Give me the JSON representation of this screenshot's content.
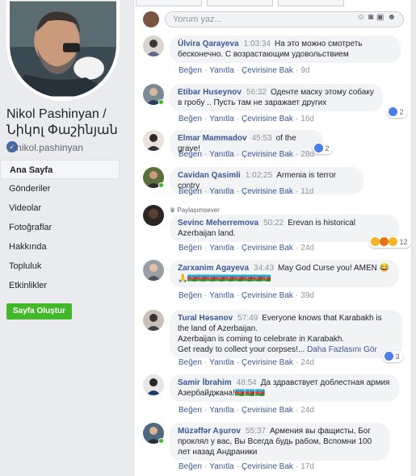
{
  "sidebar": {
    "page_name": "Nikol Pashinyan / Նիկոլ Փաշինյան",
    "verified_mark": "✓",
    "handle": "@nikol.pashinyan",
    "nav_items": [
      "Ana Sayfa",
      "Gönderiler",
      "Videolar",
      "Fotoğraflar",
      "Hakkında",
      "Topluluk",
      "Etkinlikler"
    ],
    "create_page_label": "Sayfa Oluştur"
  },
  "composer": {
    "placeholder": "Yorum yaz...",
    "icons": [
      "emoji-icon",
      "camera-icon",
      "gif-icon",
      "sticker-icon"
    ]
  },
  "labels": {
    "like": "Beğen",
    "reply": "Yanıtla",
    "translate": "Çevirisine Bak",
    "sep": "·",
    "sharer": "Paylaşımsever",
    "see_more": "Daha Fazlasını Gör"
  },
  "comments": [
    {
      "author": "Ülvira Qarayeva",
      "time": "1:03:34",
      "text": "На это можно смотреть бесконечно. С возрастающим удовольствием",
      "ago": "9d"
    },
    {
      "author": "Etibar Huseynov",
      "time": "56:32",
      "text": "Оденте маску этому собаку в гробу .. Пусть там не заражает других",
      "ago": "16d",
      "reactions": "2"
    },
    {
      "author": "Elmar Mammadov",
      "time": "45:53",
      "text": "of the grave!",
      "ago": "28d",
      "reactions": "2"
    },
    {
      "author": "Cavidan Qasimli",
      "time": "1:02:25",
      "text": "Armenia is terror contry",
      "ago": "11d"
    },
    {
      "author": "Sevinc Meherremova",
      "time": "50:22",
      "text": "Erevan is historical Azerbaijan land.",
      "ago": "24d",
      "reactions": "12"
    },
    {
      "author": "Zarxanim Agayeva",
      "time": "34:43",
      "text": "May God Curse you! AMEN 😂",
      "text2": "🙏🇦🇿🇦🇿🇦🇿🇦🇿🇦🇿🇦🇿🇦🇿🇦🇿🇦🇿",
      "ago": "39d"
    },
    {
      "author": "Tural Həsənov",
      "time": "57:49",
      "text": "Everyone knows that Karabakh is the land of Azerbaijan.",
      "text2": "Azerbaijan is coming to celebrate in Karabakh.",
      "text3": "Get ready to collect your corpses!...",
      "ago": "24d",
      "reactions": "3"
    },
    {
      "author": "Samir İbrahim",
      "time": "48:54",
      "text": "Да здравствует доблестная армия Азербайджана!🇦🇿🇦🇿🇦🇿",
      "ago": "24d"
    },
    {
      "author": "Müzəffər Aşurov",
      "time": "55:37",
      "text": "Армения вы фащисты, Бог проклял у вас, Вы Всегда будь рабом, Вспомни 100 лет назад Андраники",
      "ago": "17d"
    }
  ],
  "colors": {
    "link": "#385898",
    "muted": "#90949c",
    "bubble": "#f2f3f5",
    "create_button": "#42b72a",
    "verified": "#4267b2",
    "online": "#42b72a"
  }
}
